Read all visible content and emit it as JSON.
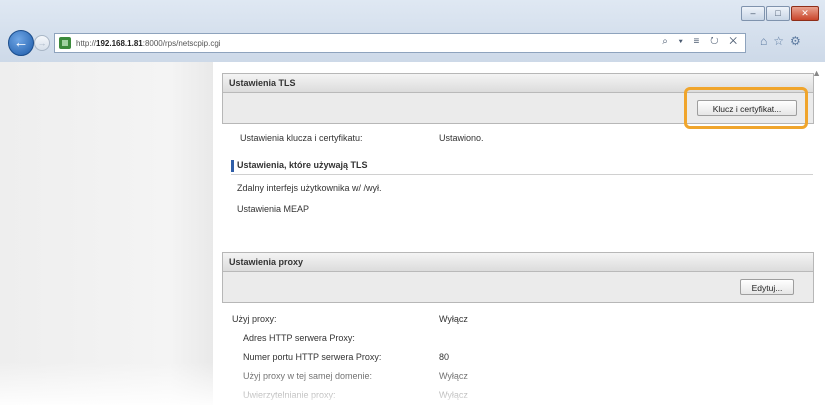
{
  "browser": {
    "url_prefix": "http://",
    "url_host": "192.168.1.81",
    "url_rest": ":8000/rps/netscpip.cgi",
    "address_tools": "⌕ ▾ ≡ ↻ ✕",
    "window_buttons": {
      "minimize": "–",
      "maximize": "□",
      "close": "✕"
    },
    "toolbar_icons": {
      "home": "⌂",
      "favorites": "☆",
      "tools": "⚙"
    },
    "back": "←",
    "forward": "→"
  },
  "tls_panel": {
    "title": "Ustawienia TLS",
    "button": "Klucz i certyfikat...",
    "key_cert_label": "Ustawienia klucza i certyfikatu:",
    "key_cert_value": "Ustawiono.",
    "section_title": "Ustawienia, które używają TLS",
    "item_remote_ui": "Zdalny interfejs użytkownika w/ /wył.",
    "item_meap": "Ustawienia MEAP"
  },
  "proxy_panel": {
    "title": "Ustawienia proxy",
    "button": "Edytuj...",
    "use_proxy_label": "Użyj proxy:",
    "use_proxy_value": "Wyłącz",
    "http_address_label": "Adres HTTP serwera Proxy:",
    "http_address_value": "",
    "http_port_label": "Numer portu HTTP serwera Proxy:",
    "http_port_value": "80",
    "same_domain_label": "Użyj proxy w tej samej domenie:",
    "same_domain_value": "Wyłącz",
    "auth_label": "Uwierzytelnianie proxy:",
    "auth_value": "Wyłącz"
  },
  "colors": {
    "highlight": "#f0a52c",
    "section_bar": "#2f5ea8"
  }
}
